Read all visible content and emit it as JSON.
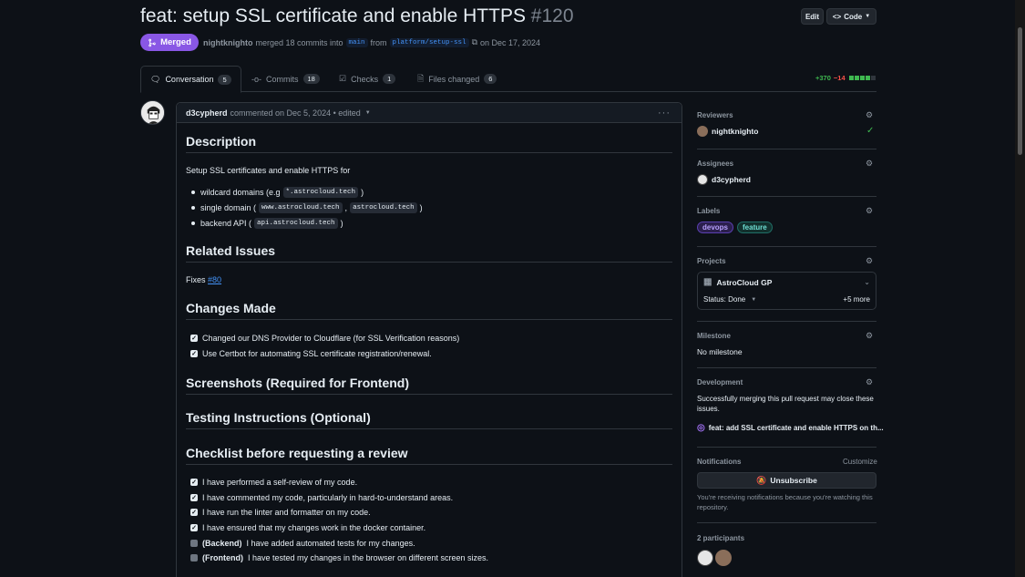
{
  "pr": {
    "title": "feat: setup SSL certificate and enable HTTPS",
    "number": "#120",
    "status": "Merged",
    "author": "nightknighto",
    "merged_text": "merged 18 commits into",
    "base_branch": "main",
    "from_text": "from",
    "head_branch": "platform/setup-ssl",
    "date_text": "on Dec 17, 2024"
  },
  "header_buttons": {
    "edit": "Edit",
    "code": "Code"
  },
  "tabs": [
    {
      "label": "Conversation",
      "count": "5"
    },
    {
      "label": "Commits",
      "count": "18"
    },
    {
      "label": "Checks",
      "count": "1"
    },
    {
      "label": "Files changed",
      "count": "6"
    }
  ],
  "diffstat": {
    "additions": "+370",
    "deletions": "−14"
  },
  "comment": {
    "author": "d3cypherd",
    "meta": "commented on Dec 5, 2024 • edited",
    "description_heading": "Description",
    "description_text": "Setup SSL certificates and enable HTTPS for",
    "domains": [
      {
        "label": "wildcard domains (e.g",
        "codes": [
          "*.astrocloud.tech"
        ],
        "suffix": ")"
      },
      {
        "label": "single domain (",
        "codes": [
          "www.astrocloud.tech",
          "astrocloud.tech"
        ],
        "suffix": ")"
      },
      {
        "label": "backend API (",
        "codes": [
          "api.astrocloud.tech"
        ],
        "suffix": ")"
      }
    ],
    "related_heading": "Related Issues",
    "fixes_text": "Fixes",
    "fixes_link": "#80",
    "changes_heading": "Changes Made",
    "changes": [
      "Changed our DNS Provider to Cloudflare (for SSL Verification reasons)",
      "Use Certbot for automating SSL certificate registration/renewal."
    ],
    "screenshots_heading": "Screenshots (Required for Frontend)",
    "testing_heading": "Testing Instructions (Optional)",
    "checklist_heading": "Checklist before requesting a review",
    "checklist": [
      {
        "prefix": "",
        "text": "I have performed a self-review of my code.",
        "checked": true
      },
      {
        "prefix": "",
        "text": "I have commented my code, particularly in hard-to-understand areas.",
        "checked": true
      },
      {
        "prefix": "",
        "text": "I have run the linter and formatter on my code.",
        "checked": true
      },
      {
        "prefix": "",
        "text": "I have ensured that my changes work in the docker container.",
        "checked": true
      },
      {
        "prefix": "(Backend)",
        "text": "I have added automated tests for my changes.",
        "checked": false
      },
      {
        "prefix": "(Frontend)",
        "text": "I have tested my changes in the browser on different screen sizes.",
        "checked": false
      }
    ]
  },
  "sidebar": {
    "reviewers_label": "Reviewers",
    "reviewer": "nightknighto",
    "assignees_label": "Assignees",
    "assignee": "d3cypherd",
    "labels_label": "Labels",
    "labels": [
      {
        "name": "devops",
        "color": "#7c4dff"
      },
      {
        "name": "feature",
        "color": "#3fb8af"
      }
    ],
    "projects_label": "Projects",
    "project_name": "AstroCloud GP",
    "project_status": "Status: Done",
    "project_more": "+5 more",
    "milestone_label": "Milestone",
    "milestone_value": "No milestone",
    "development_label": "Development",
    "development_text": "Successfully merging this pull request may close these issues.",
    "development_issue": "feat: add SSL certificate and enable HTTPS on th...",
    "notifications_label": "Notifications",
    "customize": "Customize",
    "unsubscribe": "Unsubscribe",
    "notif_text": "You're receiving notifications because you're watching this repository.",
    "participants_label": "2 participants"
  },
  "colors": {
    "merged": "#8957e5",
    "accent": "#4493f8",
    "success": "#3fb950",
    "danger": "#f85149"
  },
  "icons": [
    "merge-icon",
    "code-icon",
    "copy-icon",
    "conversation-icon",
    "commits-icon",
    "checks-icon",
    "files-icon",
    "kebab-icon",
    "gear-icon",
    "check-icon",
    "table-icon",
    "chevron-down-icon",
    "issue-closed-icon",
    "bell-slash-icon"
  ]
}
